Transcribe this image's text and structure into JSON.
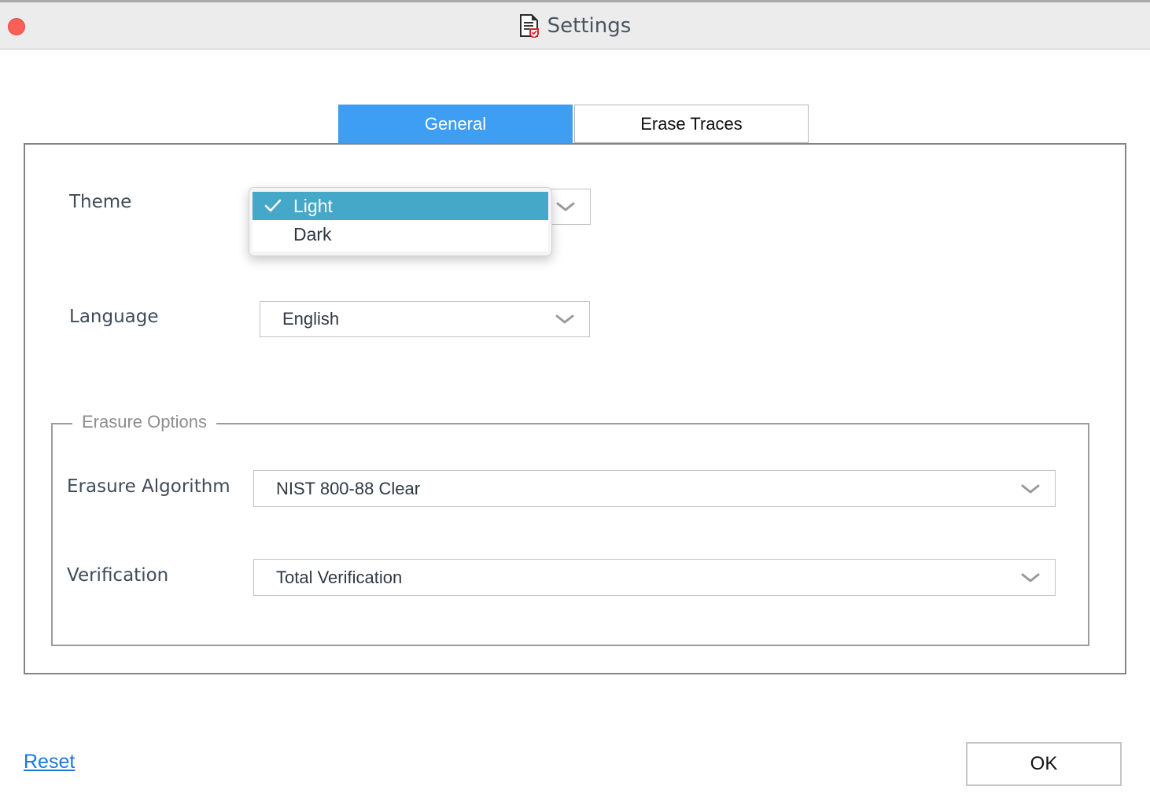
{
  "window": {
    "title": "Settings",
    "title_icon": "document-shield-icon",
    "close_button_icon": "close-circle-icon",
    "close_button_color": "#fb5f57",
    "titlebar_bg": "#ececec"
  },
  "tabs": {
    "active_index": 0,
    "items": [
      {
        "label": "General",
        "active": true
      },
      {
        "label": "Erase Traces",
        "active": false
      }
    ],
    "active_color": "#3d9ef3"
  },
  "general": {
    "theme": {
      "label": "Theme",
      "value": "Light",
      "chevron_icon": "chevron-down-icon",
      "dropdown_open": true,
      "options": [
        {
          "label": "Light",
          "selected": true
        },
        {
          "label": "Dark",
          "selected": false
        }
      ],
      "highlight_color": "#46a8c8",
      "check_icon": "check-icon"
    },
    "language": {
      "label": "Language",
      "value": "English",
      "chevron_icon": "chevron-down-icon"
    }
  },
  "erasure_options": {
    "legend": "Erasure Options",
    "algorithm": {
      "label": "Erasure Algorithm",
      "value": "NIST 800-88 Clear",
      "chevron_icon": "chevron-down-icon"
    },
    "verification": {
      "label": "Verification",
      "value": "Total Verification",
      "chevron_icon": "chevron-down-icon"
    }
  },
  "footer": {
    "reset_label": "Reset",
    "reset_color": "#1878dc",
    "ok_label": "OK"
  }
}
